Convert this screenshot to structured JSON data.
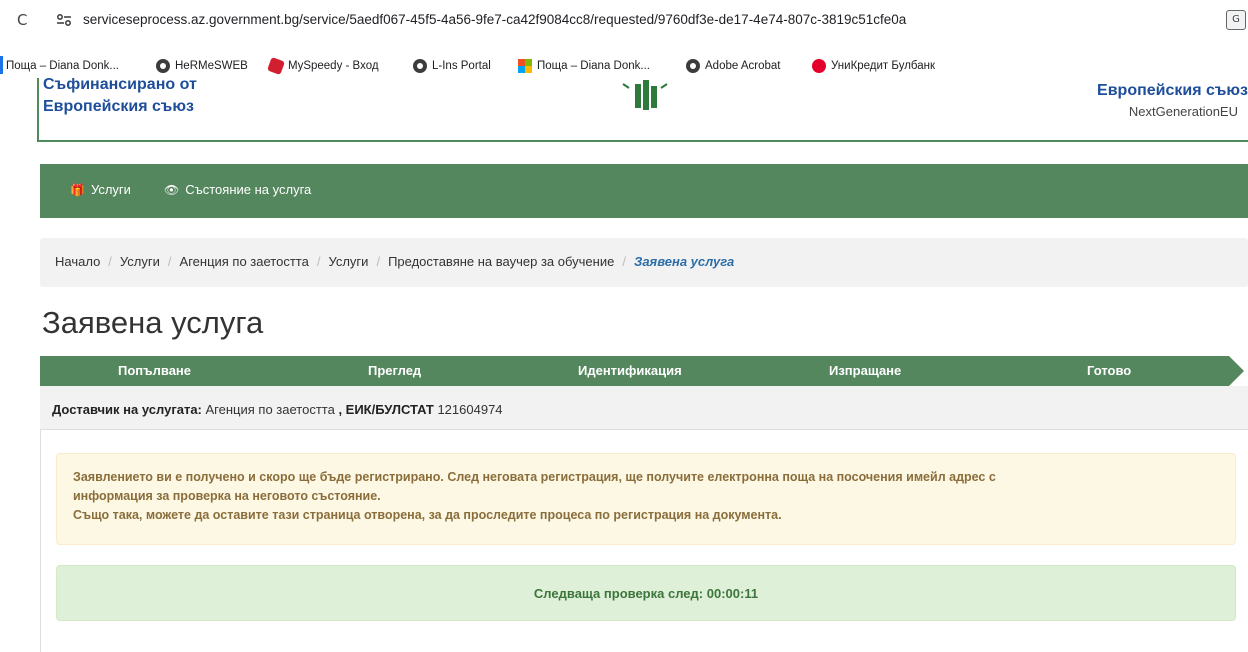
{
  "browser": {
    "url_host": "serviceseprocess.az.government.bg",
    "url_path": "/service/5aedf067-45f5-4a56-9fe7-ca42f9084cc8/requested/9760df3e-de17-4e74-807c-3819c51cfe0a",
    "translate_label": "G"
  },
  "bookmarks": [
    {
      "label": "Поща – Diana Donk...",
      "icon": "outlook-icon"
    },
    {
      "label": "HeRMeSWEB",
      "icon": "globe-icon"
    },
    {
      "label": "MySpeedy - Вход",
      "icon": "speedy-icon"
    },
    {
      "label": "L-Ins Portal",
      "icon": "globe-icon"
    },
    {
      "label": "Поща – Diana Donk...",
      "icon": "microsoft-icon"
    },
    {
      "label": "Adobe Acrobat",
      "icon": "globe-icon"
    },
    {
      "label": "УниКредит Булбанк",
      "icon": "unicredit-icon"
    }
  ],
  "banner": {
    "left_line1": "Съфинансирано от",
    "left_line2": "Европейския съюз",
    "right_line1": "Европейския съюз",
    "right_line2": "NextGenerationEU"
  },
  "nav": {
    "services": "Услуги",
    "service_status": "Състояние на услуга"
  },
  "breadcrumb": {
    "items": [
      "Начало",
      "Услуги",
      "Агенция по заетостта",
      "Услуги",
      "Предоставяне на ваучер за обучение"
    ],
    "active": "Заявена услуга"
  },
  "page": {
    "title": "Заявена услуга"
  },
  "steps": [
    "Попълване",
    "Преглед",
    "Идентификация",
    "Изпращане",
    "Готово"
  ],
  "provider": {
    "label": "Доставчик на услугата:",
    "name": "Агенция по заетостта",
    "id_label": ", ЕИК/БУЛСТАТ",
    "id_value": "121604974"
  },
  "alerts": {
    "info_line1": "Заявлението ви е получено и скоро ще бъде регистрирано. След неговата регистрация, ще получите електронна поща на посочения имейл адрес с",
    "info_line2": "информация за проверка на неговото състояние.",
    "info_line3": "Също така, можете да оставите тази страница отворена, за да проследите процеса по регистрация на документа.",
    "next_check_label": "Следваща проверка след:",
    "next_check_time": "00:00:11"
  },
  "colors": {
    "brand_green": "#55875e",
    "eu_blue": "#1e4e9a",
    "warn_bg": "#fcf8e3",
    "success_bg": "#dff0d8"
  }
}
